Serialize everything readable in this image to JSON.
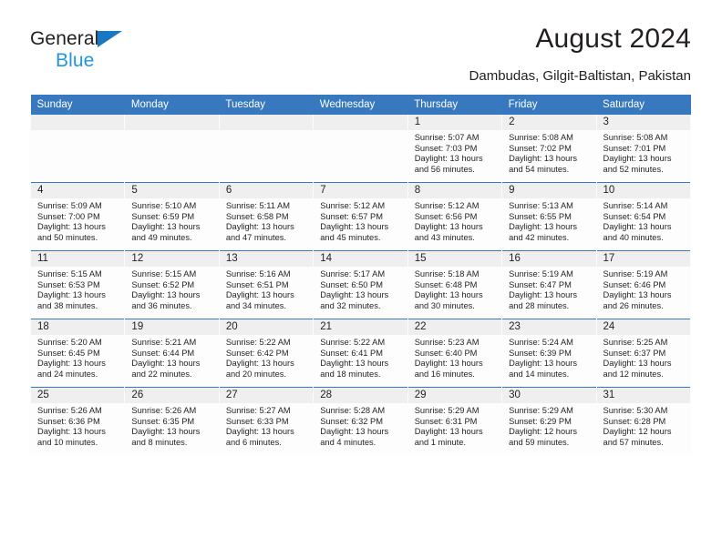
{
  "brand": {
    "line1": "General",
    "line2": "Blue",
    "triangle_color": "#1878c4",
    "blue_text_color": "#2196dd"
  },
  "header": {
    "title": "August 2024",
    "subtitle": "Dambudas, Gilgit-Baltistan, Pakistan",
    "accent_color": "#3778be",
    "daynum_band_color": "#efefef"
  },
  "calendar": {
    "weekday_headers": [
      "Sunday",
      "Monday",
      "Tuesday",
      "Wednesday",
      "Thursday",
      "Friday",
      "Saturday"
    ],
    "labels": {
      "sunrise": "Sunrise:",
      "sunset": "Sunset:",
      "daylight": "Daylight:"
    },
    "weeks": [
      [
        {
          "day": "",
          "empty": true
        },
        {
          "day": "",
          "empty": true
        },
        {
          "day": "",
          "empty": true
        },
        {
          "day": "",
          "empty": true
        },
        {
          "day": "1",
          "sunrise": "Sunrise: 5:07 AM",
          "sunset": "Sunset: 7:03 PM",
          "daylight": "Daylight: 13 hours and 56 minutes."
        },
        {
          "day": "2",
          "sunrise": "Sunrise: 5:08 AM",
          "sunset": "Sunset: 7:02 PM",
          "daylight": "Daylight: 13 hours and 54 minutes."
        },
        {
          "day": "3",
          "sunrise": "Sunrise: 5:08 AM",
          "sunset": "Sunset: 7:01 PM",
          "daylight": "Daylight: 13 hours and 52 minutes."
        }
      ],
      [
        {
          "day": "4",
          "sunrise": "Sunrise: 5:09 AM",
          "sunset": "Sunset: 7:00 PM",
          "daylight": "Daylight: 13 hours and 50 minutes."
        },
        {
          "day": "5",
          "sunrise": "Sunrise: 5:10 AM",
          "sunset": "Sunset: 6:59 PM",
          "daylight": "Daylight: 13 hours and 49 minutes."
        },
        {
          "day": "6",
          "sunrise": "Sunrise: 5:11 AM",
          "sunset": "Sunset: 6:58 PM",
          "daylight": "Daylight: 13 hours and 47 minutes."
        },
        {
          "day": "7",
          "sunrise": "Sunrise: 5:12 AM",
          "sunset": "Sunset: 6:57 PM",
          "daylight": "Daylight: 13 hours and 45 minutes."
        },
        {
          "day": "8",
          "sunrise": "Sunrise: 5:12 AM",
          "sunset": "Sunset: 6:56 PM",
          "daylight": "Daylight: 13 hours and 43 minutes."
        },
        {
          "day": "9",
          "sunrise": "Sunrise: 5:13 AM",
          "sunset": "Sunset: 6:55 PM",
          "daylight": "Daylight: 13 hours and 42 minutes."
        },
        {
          "day": "10",
          "sunrise": "Sunrise: 5:14 AM",
          "sunset": "Sunset: 6:54 PM",
          "daylight": "Daylight: 13 hours and 40 minutes."
        }
      ],
      [
        {
          "day": "11",
          "sunrise": "Sunrise: 5:15 AM",
          "sunset": "Sunset: 6:53 PM",
          "daylight": "Daylight: 13 hours and 38 minutes."
        },
        {
          "day": "12",
          "sunrise": "Sunrise: 5:15 AM",
          "sunset": "Sunset: 6:52 PM",
          "daylight": "Daylight: 13 hours and 36 minutes."
        },
        {
          "day": "13",
          "sunrise": "Sunrise: 5:16 AM",
          "sunset": "Sunset: 6:51 PM",
          "daylight": "Daylight: 13 hours and 34 minutes."
        },
        {
          "day": "14",
          "sunrise": "Sunrise: 5:17 AM",
          "sunset": "Sunset: 6:50 PM",
          "daylight": "Daylight: 13 hours and 32 minutes."
        },
        {
          "day": "15",
          "sunrise": "Sunrise: 5:18 AM",
          "sunset": "Sunset: 6:48 PM",
          "daylight": "Daylight: 13 hours and 30 minutes."
        },
        {
          "day": "16",
          "sunrise": "Sunrise: 5:19 AM",
          "sunset": "Sunset: 6:47 PM",
          "daylight": "Daylight: 13 hours and 28 minutes."
        },
        {
          "day": "17",
          "sunrise": "Sunrise: 5:19 AM",
          "sunset": "Sunset: 6:46 PM",
          "daylight": "Daylight: 13 hours and 26 minutes."
        }
      ],
      [
        {
          "day": "18",
          "sunrise": "Sunrise: 5:20 AM",
          "sunset": "Sunset: 6:45 PM",
          "daylight": "Daylight: 13 hours and 24 minutes."
        },
        {
          "day": "19",
          "sunrise": "Sunrise: 5:21 AM",
          "sunset": "Sunset: 6:44 PM",
          "daylight": "Daylight: 13 hours and 22 minutes."
        },
        {
          "day": "20",
          "sunrise": "Sunrise: 5:22 AM",
          "sunset": "Sunset: 6:42 PM",
          "daylight": "Daylight: 13 hours and 20 minutes."
        },
        {
          "day": "21",
          "sunrise": "Sunrise: 5:22 AM",
          "sunset": "Sunset: 6:41 PM",
          "daylight": "Daylight: 13 hours and 18 minutes."
        },
        {
          "day": "22",
          "sunrise": "Sunrise: 5:23 AM",
          "sunset": "Sunset: 6:40 PM",
          "daylight": "Daylight: 13 hours and 16 minutes."
        },
        {
          "day": "23",
          "sunrise": "Sunrise: 5:24 AM",
          "sunset": "Sunset: 6:39 PM",
          "daylight": "Daylight: 13 hours and 14 minutes."
        },
        {
          "day": "24",
          "sunrise": "Sunrise: 5:25 AM",
          "sunset": "Sunset: 6:37 PM",
          "daylight": "Daylight: 13 hours and 12 minutes."
        }
      ],
      [
        {
          "day": "25",
          "sunrise": "Sunrise: 5:26 AM",
          "sunset": "Sunset: 6:36 PM",
          "daylight": "Daylight: 13 hours and 10 minutes."
        },
        {
          "day": "26",
          "sunrise": "Sunrise: 5:26 AM",
          "sunset": "Sunset: 6:35 PM",
          "daylight": "Daylight: 13 hours and 8 minutes."
        },
        {
          "day": "27",
          "sunrise": "Sunrise: 5:27 AM",
          "sunset": "Sunset: 6:33 PM",
          "daylight": "Daylight: 13 hours and 6 minutes."
        },
        {
          "day": "28",
          "sunrise": "Sunrise: 5:28 AM",
          "sunset": "Sunset: 6:32 PM",
          "daylight": "Daylight: 13 hours and 4 minutes."
        },
        {
          "day": "29",
          "sunrise": "Sunrise: 5:29 AM",
          "sunset": "Sunset: 6:31 PM",
          "daylight": "Daylight: 13 hours and 1 minute."
        },
        {
          "day": "30",
          "sunrise": "Sunrise: 5:29 AM",
          "sunset": "Sunset: 6:29 PM",
          "daylight": "Daylight: 12 hours and 59 minutes."
        },
        {
          "day": "31",
          "sunrise": "Sunrise: 5:30 AM",
          "sunset": "Sunset: 6:28 PM",
          "daylight": "Daylight: 12 hours and 57 minutes."
        }
      ]
    ]
  }
}
